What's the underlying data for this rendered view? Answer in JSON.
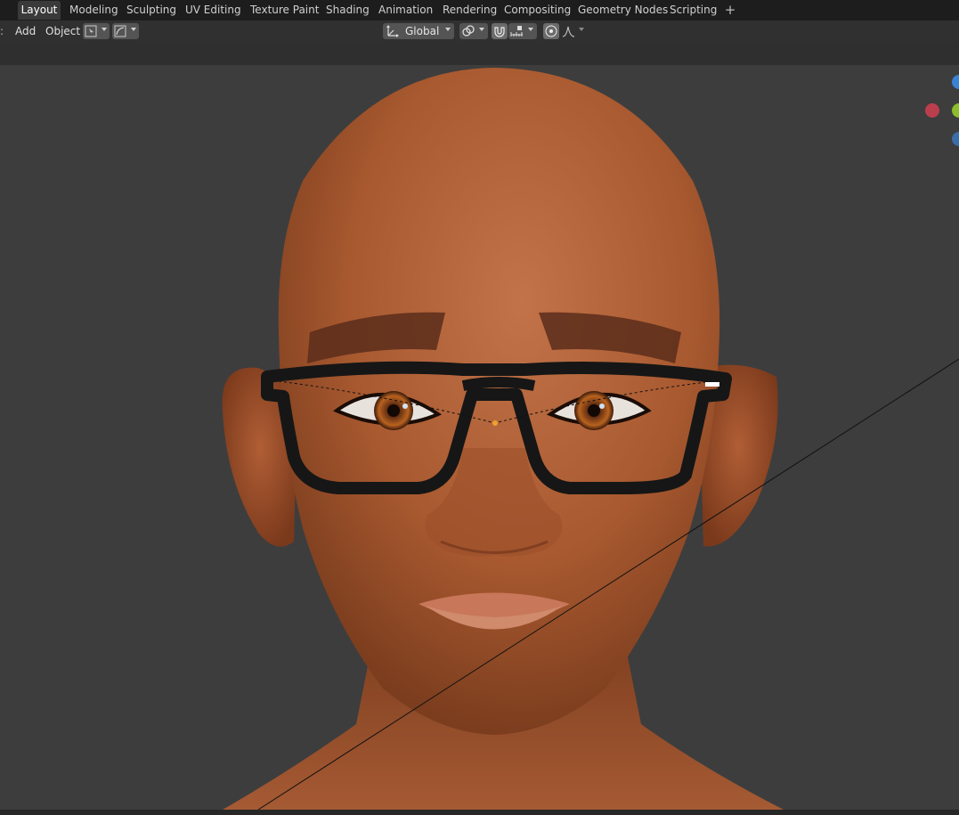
{
  "workspace_tabs": [
    {
      "label": "Layout",
      "active": true
    },
    {
      "label": "Modeling",
      "active": false
    },
    {
      "label": "Sculpting",
      "active": false
    },
    {
      "label": "UV Editing",
      "active": false
    },
    {
      "label": "Texture Paint",
      "active": false
    },
    {
      "label": "Shading",
      "active": false
    },
    {
      "label": "Animation",
      "active": false
    },
    {
      "label": "Rendering",
      "active": false
    },
    {
      "label": "Compositing",
      "active": false
    },
    {
      "label": "Geometry Nodes",
      "active": false
    },
    {
      "label": "Scripting",
      "active": false
    }
  ],
  "add_tab_label": "+",
  "header": {
    "menu_add": "Add",
    "menu_object": "Object",
    "transform_orientation": "Global"
  },
  "gizmo_colors": {
    "x": "#d13e50",
    "y": "#8bbf2a",
    "z": "#3a82d4"
  },
  "skin_color": "#b8683f"
}
